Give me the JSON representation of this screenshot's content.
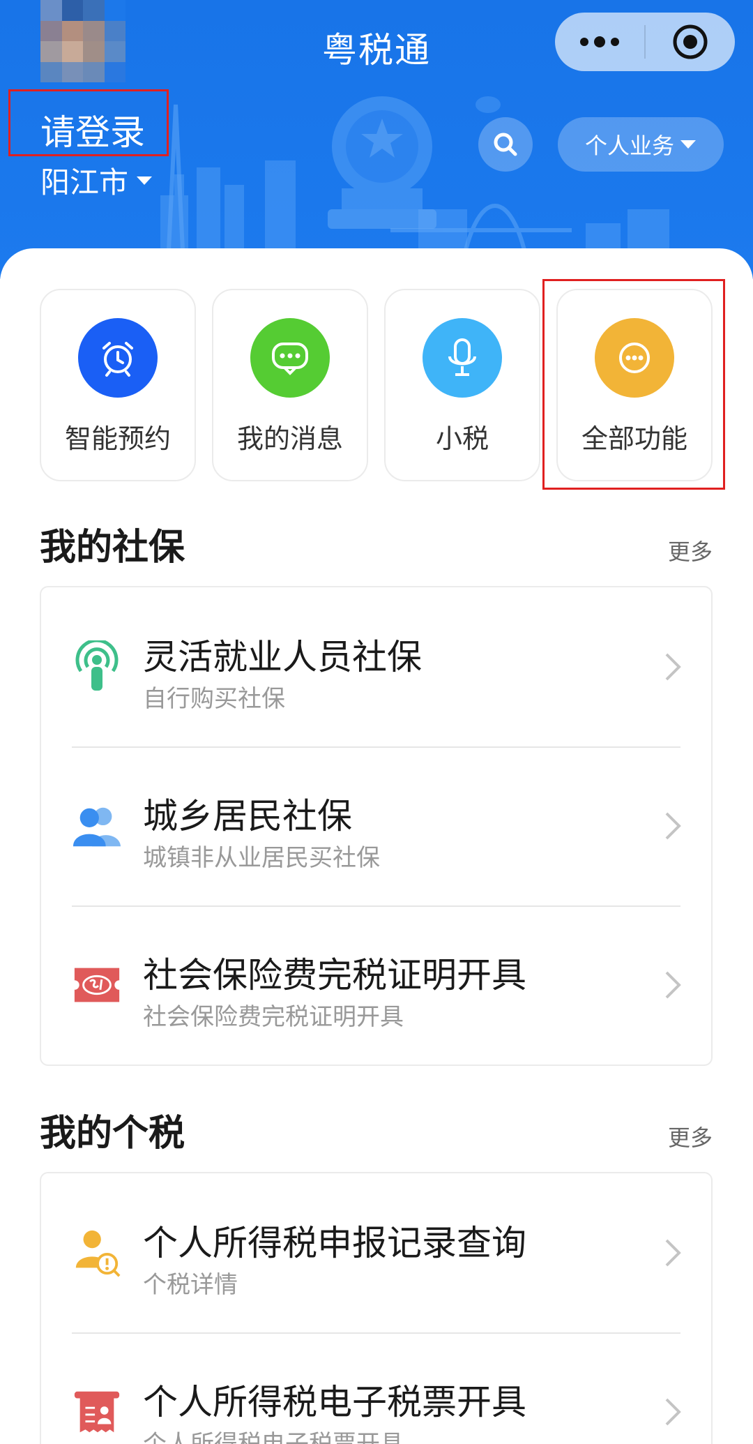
{
  "header": {
    "app_title": "粤税通",
    "login_label": "请登录",
    "city_label": "阳江市",
    "business_label": "个人业务"
  },
  "quick_actions": [
    {
      "label": "智能预约",
      "icon": "alarm-clock-icon",
      "color": "#1a5ff5"
    },
    {
      "label": "我的消息",
      "icon": "chat-bubble-icon",
      "color": "#55cc33"
    },
    {
      "label": "小税",
      "icon": "microphone-icon",
      "color": "#3fb4f8"
    },
    {
      "label": "全部功能",
      "icon": "more-dots-icon",
      "color": "#f2b437"
    }
  ],
  "social_security": {
    "title": "我的社保",
    "more_label": "更多",
    "items": [
      {
        "title": "灵活就业人员社保",
        "subtitle": "自行购买社保",
        "icon": "flexible-worker-icon"
      },
      {
        "title": "城乡居民社保",
        "subtitle": "城镇非从业居民买社保",
        "icon": "residents-icon"
      },
      {
        "title": "社会保险费完税证明开具",
        "subtitle": "社会保险费完税证明开具",
        "icon": "si-certificate-icon"
      }
    ]
  },
  "personal_tax": {
    "title": "我的个税",
    "more_label": "更多",
    "items": [
      {
        "title": "个人所得税申报记录查询",
        "subtitle": "个税详情",
        "icon": "tax-record-query-icon"
      },
      {
        "title": "个人所得税电子税票开具",
        "subtitle": "个人所得税电子税票开具",
        "icon": "e-tax-receipt-icon"
      }
    ]
  },
  "colors": {
    "header_blue": "#1874e8",
    "highlight_red": "#e02020"
  }
}
